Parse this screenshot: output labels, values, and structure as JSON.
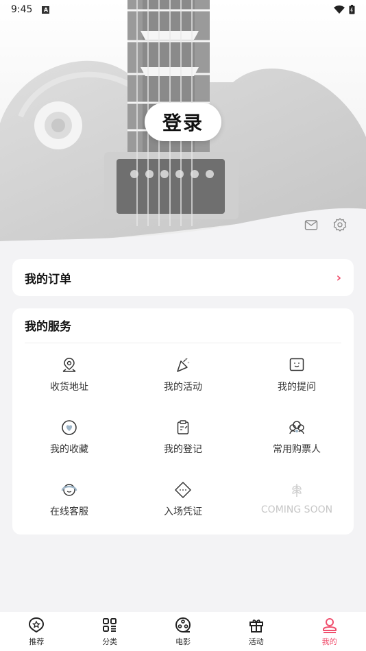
{
  "status": {
    "time": "9:45"
  },
  "hero": {
    "login_label": "登录"
  },
  "orders": {
    "title": "我的订单"
  },
  "services": {
    "title": "我的服务",
    "items": [
      {
        "label": "收货地址",
        "icon": "location-pin-icon"
      },
      {
        "label": "我的活动",
        "icon": "party-popper-icon"
      },
      {
        "label": "我的提问",
        "icon": "chat-face-icon"
      },
      {
        "label": "我的收藏",
        "icon": "heart-icon"
      },
      {
        "label": "我的登记",
        "icon": "clipboard-icon"
      },
      {
        "label": "常用购票人",
        "icon": "users-icon"
      },
      {
        "label": "在线客服",
        "icon": "headset-icon"
      },
      {
        "label": "入场凭证",
        "icon": "ticket-icon"
      },
      {
        "label": "COMING SOON",
        "icon": "wheat-icon"
      }
    ]
  },
  "tabs": [
    {
      "label": "推荐",
      "icon": "star-badge-icon"
    },
    {
      "label": "分类",
      "icon": "grid-icon"
    },
    {
      "label": "电影",
      "icon": "film-reel-icon"
    },
    {
      "label": "活动",
      "icon": "gift-icon"
    },
    {
      "label": "我的",
      "icon": "user-icon",
      "active": true
    }
  ],
  "colors": {
    "accent": "#f0506e",
    "background": "#f3f3f5"
  }
}
